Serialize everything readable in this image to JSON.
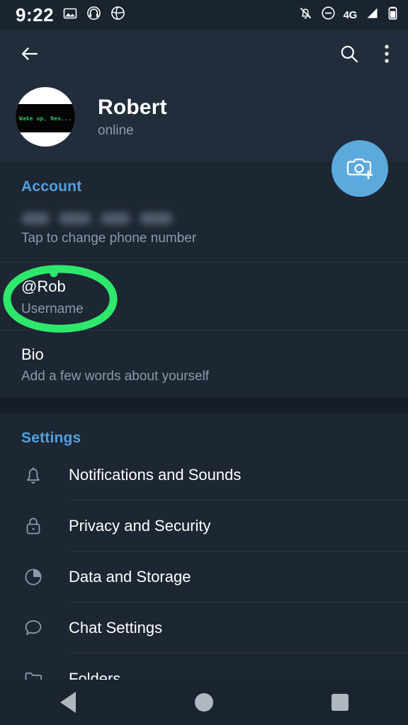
{
  "statusbar": {
    "time": "9:22",
    "left_icons": [
      "image-icon",
      "headphones-icon",
      "globe-icon"
    ],
    "network_label": "4G",
    "right_icons": [
      "bell-off-icon",
      "do-not-disturb-icon",
      "signal-icon",
      "battery-icon"
    ]
  },
  "appbar": {
    "back_icon": "back-arrow-icon",
    "search_icon": "search-icon",
    "menu_icon": "more-vertical-icon"
  },
  "profile": {
    "name": "Robert",
    "status": "online",
    "avatar_text": "Wake up, Neo...",
    "avatar_text_color": "#2fc95c"
  },
  "fab": {
    "icon": "camera-add-icon",
    "color": "#5ca9dd"
  },
  "account": {
    "title": "Account",
    "phone_value": "",
    "phone_subtitle": "Tap to change phone number",
    "username_value": "@Rob",
    "username_subtitle": "Username",
    "bio_value": "Bio",
    "bio_subtitle": "Add a few words about yourself"
  },
  "settings": {
    "title": "Settings",
    "items": [
      {
        "label": "Notifications and Sounds",
        "icon": "bell-icon"
      },
      {
        "label": "Privacy and Security",
        "icon": "lock-icon"
      },
      {
        "label": "Data and Storage",
        "icon": "pie-chart-icon"
      },
      {
        "label": "Chat Settings",
        "icon": "chat-bubble-icon"
      },
      {
        "label": "Folders",
        "icon": "folder-icon"
      }
    ]
  },
  "annotation": {
    "shape": "ellipse-highlight",
    "color": "#2ee86b",
    "target": "@Rob"
  },
  "navbar": {
    "back": "nav-back-icon",
    "home": "nav-home-icon",
    "recents": "nav-recents-icon"
  },
  "theme": {
    "header_bg": "#212d3b",
    "content_bg": "#1d2633",
    "gap_bg": "#151d27",
    "accent": "#53a0de",
    "muted_text": "#8d9aa8",
    "divider": "#293444"
  }
}
